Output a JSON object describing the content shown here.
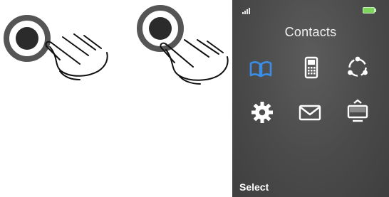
{
  "gestures": [
    {
      "icon": "tap-gesture-icon"
    },
    {
      "icon": "tap-gesture-icon"
    }
  ],
  "phone": {
    "status_bar": {
      "signal_icon": "signal-strength-icon",
      "battery_icon": "battery-icon",
      "battery_color": "#7ed65a"
    },
    "screen_title": "Contacts",
    "menu_icons": [
      {
        "name": "phonebook-icon",
        "color": "#3a8ee8"
      },
      {
        "name": "mobile-phone-icon",
        "color": "#ffffff"
      },
      {
        "name": "network-icon",
        "color": "#ffffff"
      },
      {
        "name": "settings-gear-icon",
        "color": "#ffffff"
      },
      {
        "name": "messages-envelope-icon",
        "color": "#ffffff"
      },
      {
        "name": "display-tv-icon",
        "color": "#ffffff"
      }
    ],
    "soft_keys": {
      "left": "Select"
    }
  }
}
